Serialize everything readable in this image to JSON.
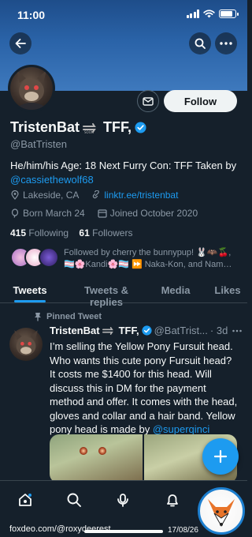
{
  "status_bar": {
    "time": "11:00"
  },
  "profile": {
    "display_name": "TristenBat",
    "name_suffix": "TFF,",
    "handle": "@BatTristen",
    "follow_label": "Follow",
    "bio_text": "He/him/his Age: 18 Next Furry Con: TFF Taken by",
    "bio_mention": "@cassiethewolf68",
    "location": "Lakeside, CA",
    "website": "linktr.ee/tristenbat",
    "born": "Born March 24",
    "joined": "Joined October 2020",
    "following_count": "415",
    "following_label": "Following",
    "followers_count": "61",
    "followers_label": "Followers",
    "followed_by_line1": "Followed by cherry the bunnypup! 🐰🦇🍒,",
    "followed_by_line2": "🏳️‍⚧️🌸Kandi🌸🏳️‍⚧️ ⏩ Naka-Kon, and Nam…"
  },
  "tabs": [
    {
      "label": "Tweets"
    },
    {
      "label": "Tweets & replies"
    },
    {
      "label": "Media"
    },
    {
      "label": "Likes"
    }
  ],
  "pinned_tweet": {
    "pinned_label": "Pinned Tweet",
    "author_name": "TristenBat",
    "author_suffix": "TFF,",
    "author_handle": "@BatTrist...",
    "time": "· 3d",
    "body": "I’m selling the Yellow Pony Fursuit head. Who wants this cute pony Fursuit head? It costs me $1400 for this head. Will discuss this in DM for the payment method and offer. It comes with the head, gloves and collar and a hair band. Yellow pony head is made by",
    "body_mention": "@superqinci"
  },
  "watermark": {
    "text": "foxdeo.com/@roxydeerest",
    "date": "17/08/26"
  },
  "colors": {
    "background": "#15202b",
    "accent": "#1d9bf0",
    "muted_text": "#8b98a5",
    "verified": "#1d9bf0"
  }
}
